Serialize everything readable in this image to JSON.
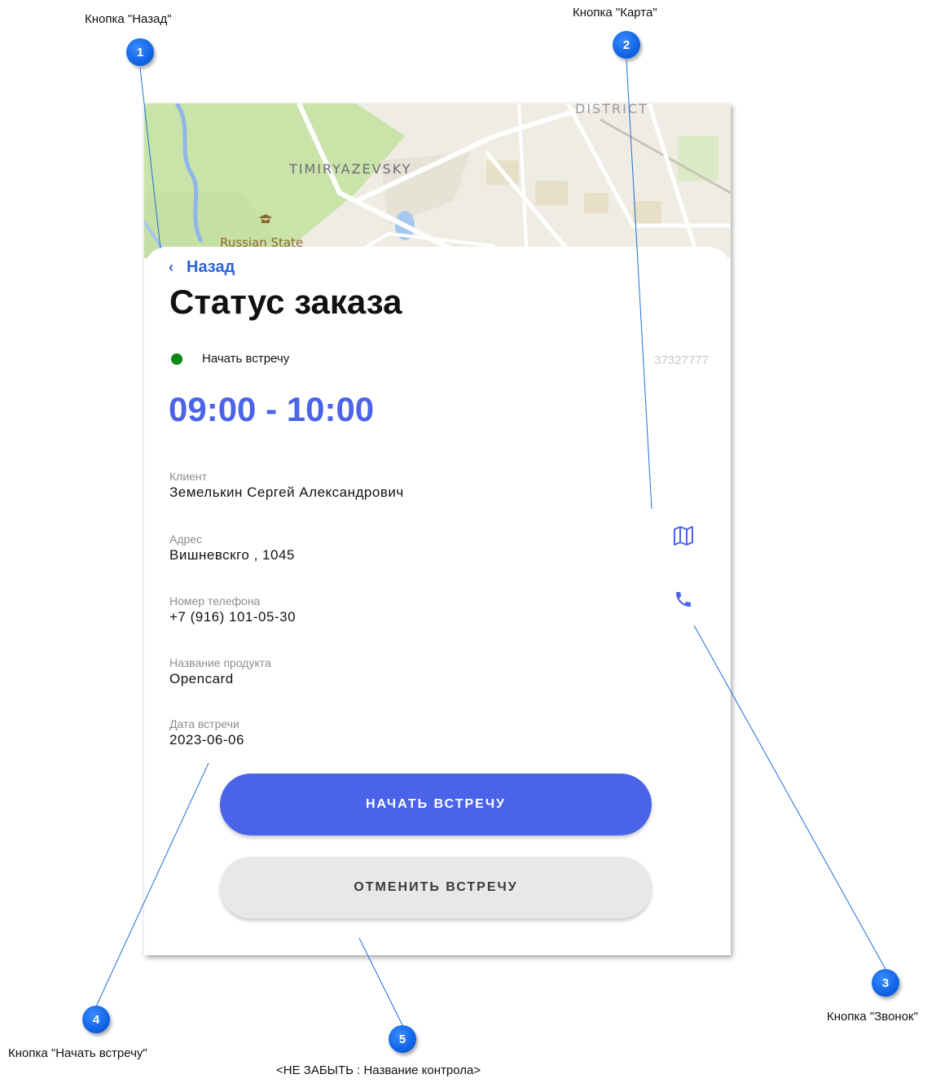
{
  "callouts": [
    {
      "number": "1",
      "label": "Кнопка \"Назад\""
    },
    {
      "number": "2",
      "label": "Кнопка \"Карта\""
    },
    {
      "number": "3",
      "label": "Кнопка \"Звонок\""
    },
    {
      "number": "4",
      "label": "Кнопка \"Начать встречу\""
    },
    {
      "number": "5",
      "label": "<НЕ ЗАБЫТЬ : Название контрола>"
    }
  ],
  "map": {
    "labels": {
      "district": "DISTRICT",
      "area": "TIMIRYAZEVSKY",
      "poi": "Russian State"
    }
  },
  "header": {
    "back_label": "Назад",
    "title": "Статус заказа"
  },
  "status": {
    "text": "Начать встречу",
    "color": "#0b8a14",
    "order_id": "37327777"
  },
  "time_range": "09:00 - 10:00",
  "fields": {
    "client": {
      "label": "Клиент",
      "value": "Земелькин  Сергей  Александрович"
    },
    "address": {
      "label": "Адрес",
      "value": "Вишневскго , 1045"
    },
    "phone": {
      "label": "Номер телефона",
      "value": "+7 (916) 101-05-30"
    },
    "product": {
      "label": "Название продукта",
      "value": "Opencard"
    },
    "date": {
      "label": "Дата встречи",
      "value": "2023-06-06"
    }
  },
  "icons": {
    "map": "map-icon",
    "phone": "phone-icon",
    "back": "chevron-left-icon"
  },
  "buttons": {
    "start": "НАЧАТЬ ВСТРЕЧУ",
    "cancel": "ОТМЕНИТЬ ВСТРЕЧУ"
  },
  "colors": {
    "accent": "#4a63e8",
    "link": "#2b63d9",
    "callout": "#0a5ee0"
  }
}
